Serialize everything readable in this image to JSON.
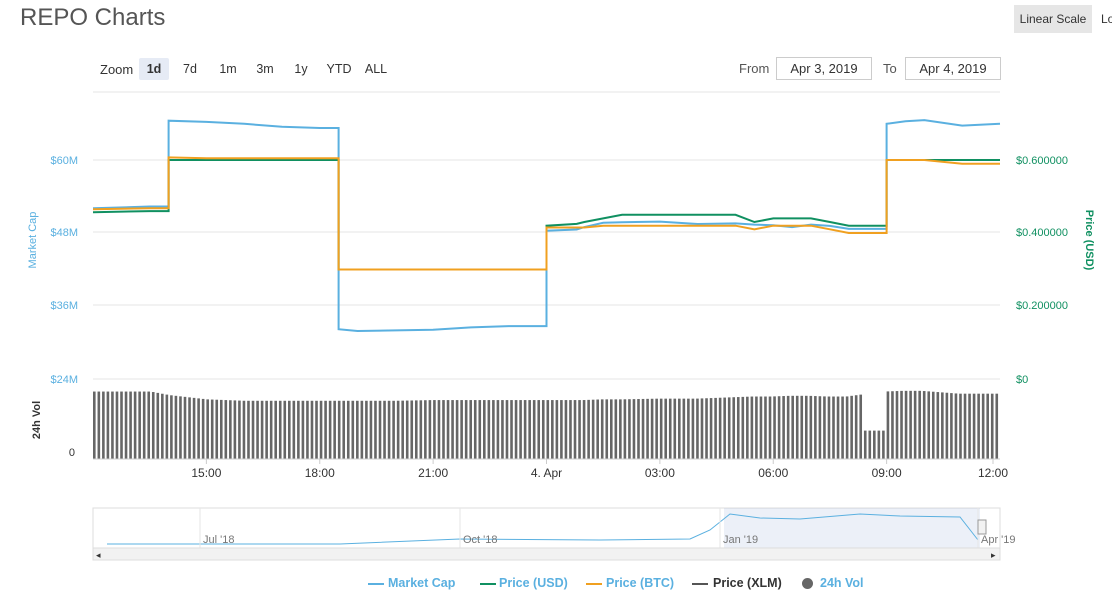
{
  "title": "REPO Charts",
  "scale_buttons": [
    "Linear Scale",
    "Lo"
  ],
  "zoom": {
    "label": "Zoom",
    "options": [
      "1d",
      "7d",
      "1m",
      "3m",
      "1y",
      "YTD",
      "ALL"
    ],
    "active": "1d"
  },
  "range": {
    "from_label": "From",
    "from_value": "Apr 3, 2019",
    "to_label": "To",
    "to_value": "Apr 4, 2019"
  },
  "colors": {
    "market_cap": "#5ab0e0",
    "price_usd": "#109061",
    "price_btc": "#f0a020",
    "price_xlm": "#555555",
    "vol": "#666666"
  },
  "chart_data": {
    "type": "line",
    "title": "",
    "left_axis": {
      "label": "Market Cap",
      "ticks": [
        "$24M",
        "$36M",
        "$48M",
        "$60M"
      ]
    },
    "right_axis": {
      "label": "Price (USD)",
      "ticks": [
        "$0",
        "$0.200000",
        "$0.400000",
        "$0.600000"
      ],
      "ylim": [
        0,
        0.7
      ]
    },
    "volume_axis": {
      "label": "24h Vol",
      "ticks": [
        "0"
      ]
    },
    "x_ticks": [
      "15:00",
      "18:00",
      "21:00",
      "4. Apr",
      "03:00",
      "06:00",
      "09:00",
      "12:00"
    ],
    "x_hours": [
      0,
      1.5,
      2,
      3,
      4,
      5,
      6,
      6.5,
      7,
      8,
      9,
      10,
      11,
      12,
      12.8,
      13,
      13.5,
      14,
      15,
      16,
      17,
      17.5,
      18,
      18.5,
      19,
      19.5,
      20,
      21,
      21.5,
      22,
      23,
      24
    ],
    "series": [
      {
        "name": "Market Cap",
        "axis": "left",
        "values": [
          52.0,
          52.3,
          66.5,
          66.3,
          66.0,
          65.5,
          65.3,
          32.0,
          31.7,
          31.8,
          31.9,
          32.3,
          32.5,
          48.3,
          48.5,
          48.9,
          49.6,
          49.7,
          49.8,
          49.4,
          49.5,
          49.3,
          49.2,
          48.9,
          49.3,
          49.1,
          48.6,
          66.0,
          66.4,
          66.6,
          65.7,
          66.0
        ]
      },
      {
        "name": "Price (USD)",
        "axis": "right",
        "values": [
          0.457,
          0.46,
          0.6,
          0.6,
          0.6,
          0.6,
          0.6,
          0.3,
          0.3,
          0.3,
          0.3,
          0.3,
          0.3,
          0.42,
          0.425,
          0.43,
          0.44,
          0.45,
          0.45,
          0.45,
          0.45,
          0.43,
          0.44,
          0.44,
          0.44,
          0.43,
          0.42,
          0.6,
          0.6,
          0.6,
          0.6,
          0.6
        ]
      },
      {
        "name": "Price (BTC)",
        "axis": "right",
        "values": [
          0.465,
          0.468,
          0.607,
          0.605,
          0.605,
          0.605,
          0.605,
          0.3,
          0.3,
          0.3,
          0.3,
          0.3,
          0.3,
          0.415,
          0.415,
          0.415,
          0.42,
          0.42,
          0.42,
          0.42,
          0.42,
          0.41,
          0.42,
          0.42,
          0.42,
          0.41,
          0.4,
          0.6,
          0.6,
          0.6,
          0.59,
          0.59
        ]
      }
    ],
    "volume_levels": [
      0.95,
      0.95,
      0.9,
      0.84,
      0.82,
      0.82,
      0.82,
      0.82,
      0.82,
      0.82,
      0.83,
      0.83,
      0.83,
      0.83,
      0.83,
      0.83,
      0.84,
      0.84,
      0.85,
      0.85,
      0.87,
      0.88,
      0.88,
      0.89,
      0.89,
      0.88,
      0.88,
      0.95,
      0.96,
      0.96,
      0.92,
      0.92
    ],
    "navigator": {
      "labels": [
        "Jul '18",
        "Oct '18",
        "Jan '19",
        "Apr '19"
      ]
    },
    "legend": [
      "Market Cap",
      "Price (USD)",
      "Price (BTC)",
      "Price (XLM)",
      "24h Vol"
    ]
  }
}
